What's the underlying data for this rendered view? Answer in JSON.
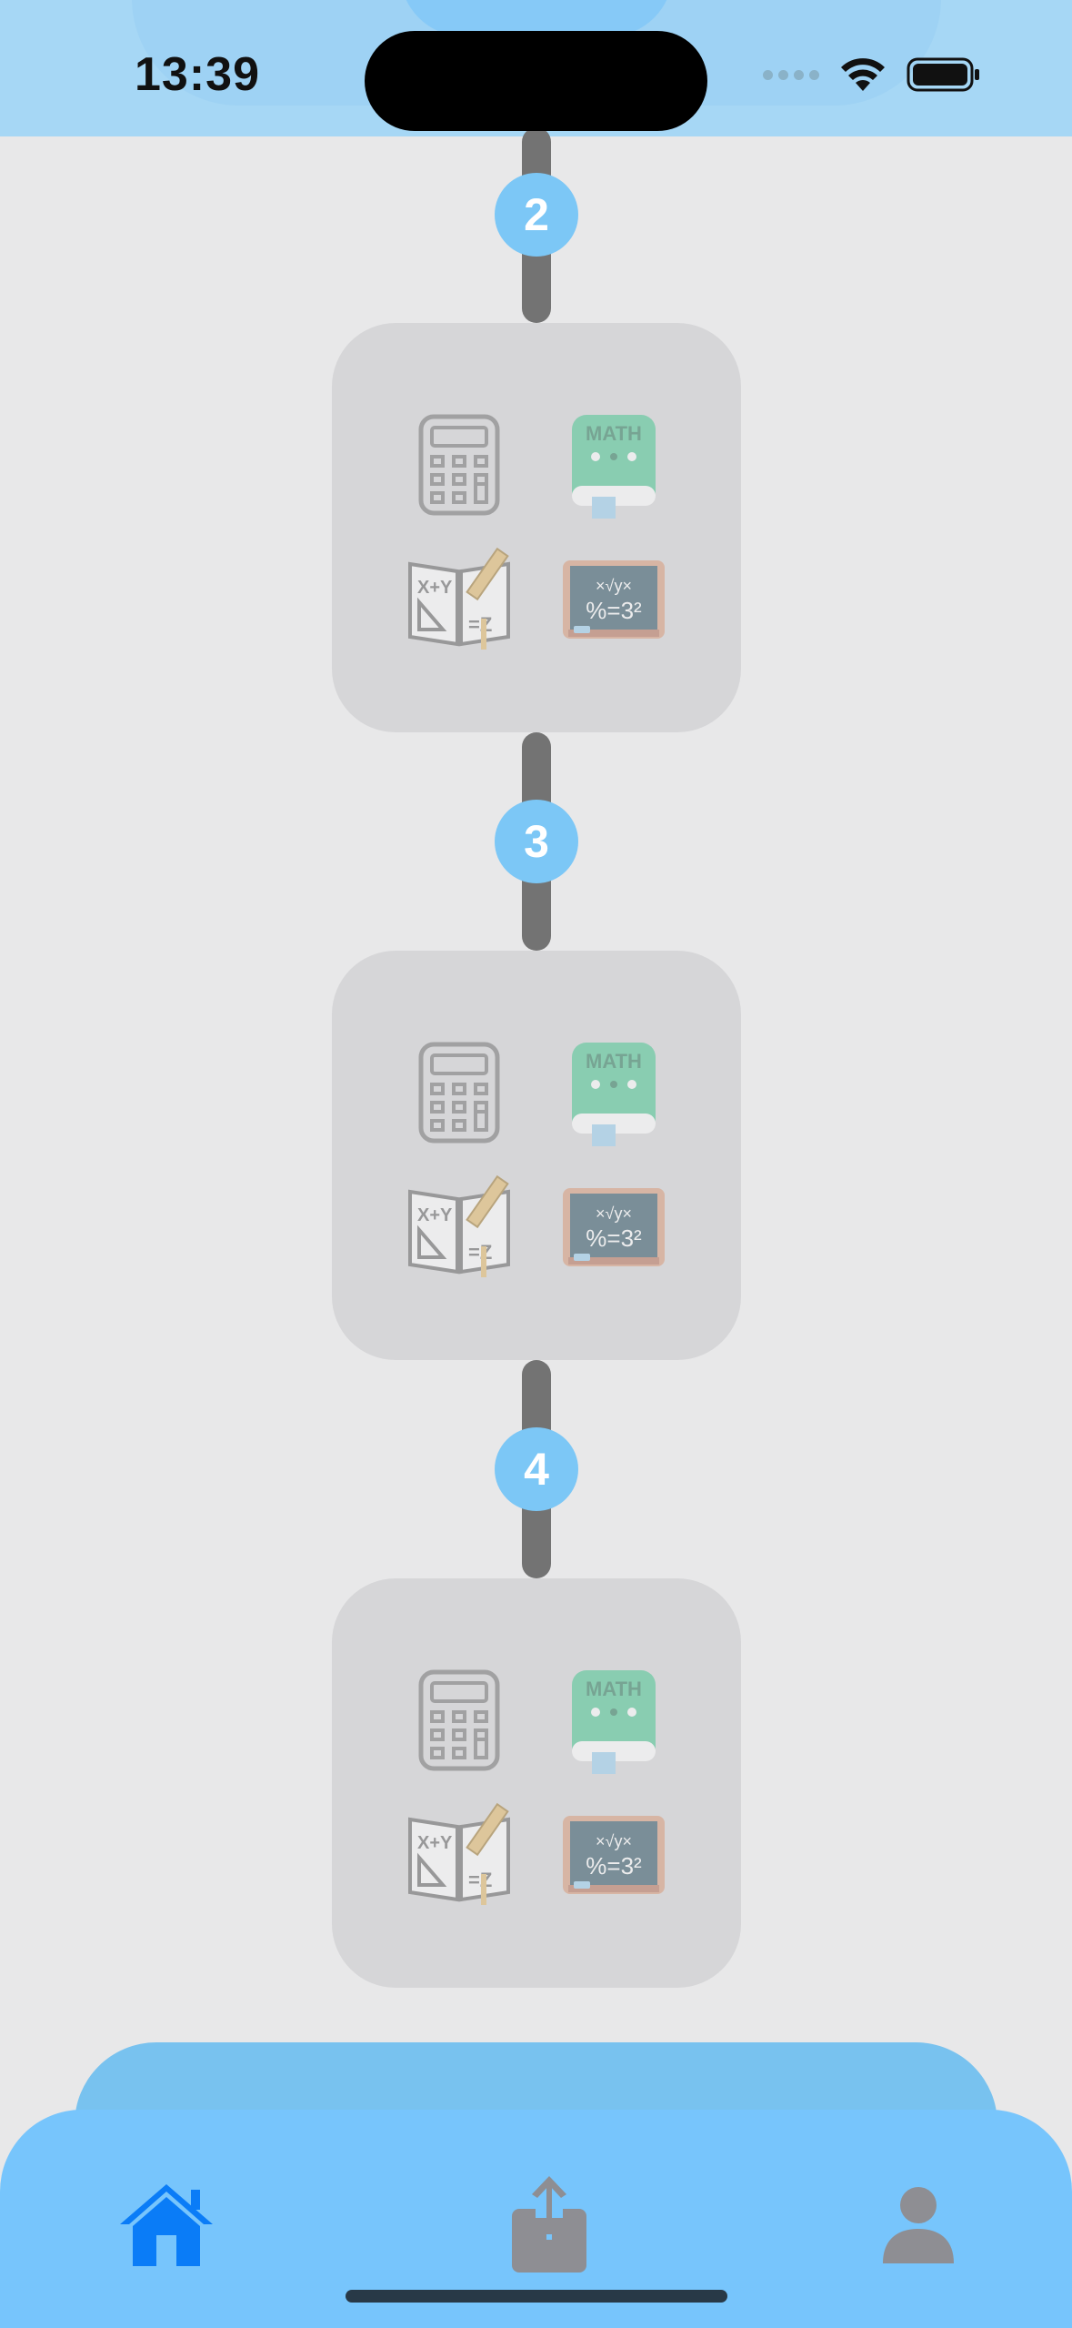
{
  "status_bar": {
    "time": "13:39",
    "icons": [
      "signal-dots-icon",
      "wifi-icon",
      "battery-icon"
    ]
  },
  "path": {
    "steps": [
      {
        "number": "2",
        "lessons": [
          "calculator-icon",
          "math-book-icon",
          "geometry-notebook-icon",
          "chalkboard-formula-icon"
        ]
      },
      {
        "number": "3",
        "lessons": [
          "calculator-icon",
          "math-book-icon",
          "geometry-notebook-icon",
          "chalkboard-formula-icon"
        ]
      },
      {
        "number": "4",
        "lessons": [
          "calculator-icon",
          "math-book-icon",
          "geometry-notebook-icon",
          "chalkboard-formula-icon"
        ]
      }
    ],
    "book_label": "MATH"
  },
  "tabbar": {
    "tabs": [
      {
        "name": "home",
        "icon": "house-icon",
        "active": true
      },
      {
        "name": "share",
        "icon": "upload-icon",
        "active": false
      },
      {
        "name": "profile",
        "icon": "person-icon",
        "active": false
      }
    ]
  },
  "colors": {
    "background": "#e8e8e9",
    "accent": "#7cc7f6",
    "tab_active": "#0a7cf7",
    "tab_inactive": "#8e8e93",
    "card": "#d6d6d8",
    "connector": "#737373"
  }
}
